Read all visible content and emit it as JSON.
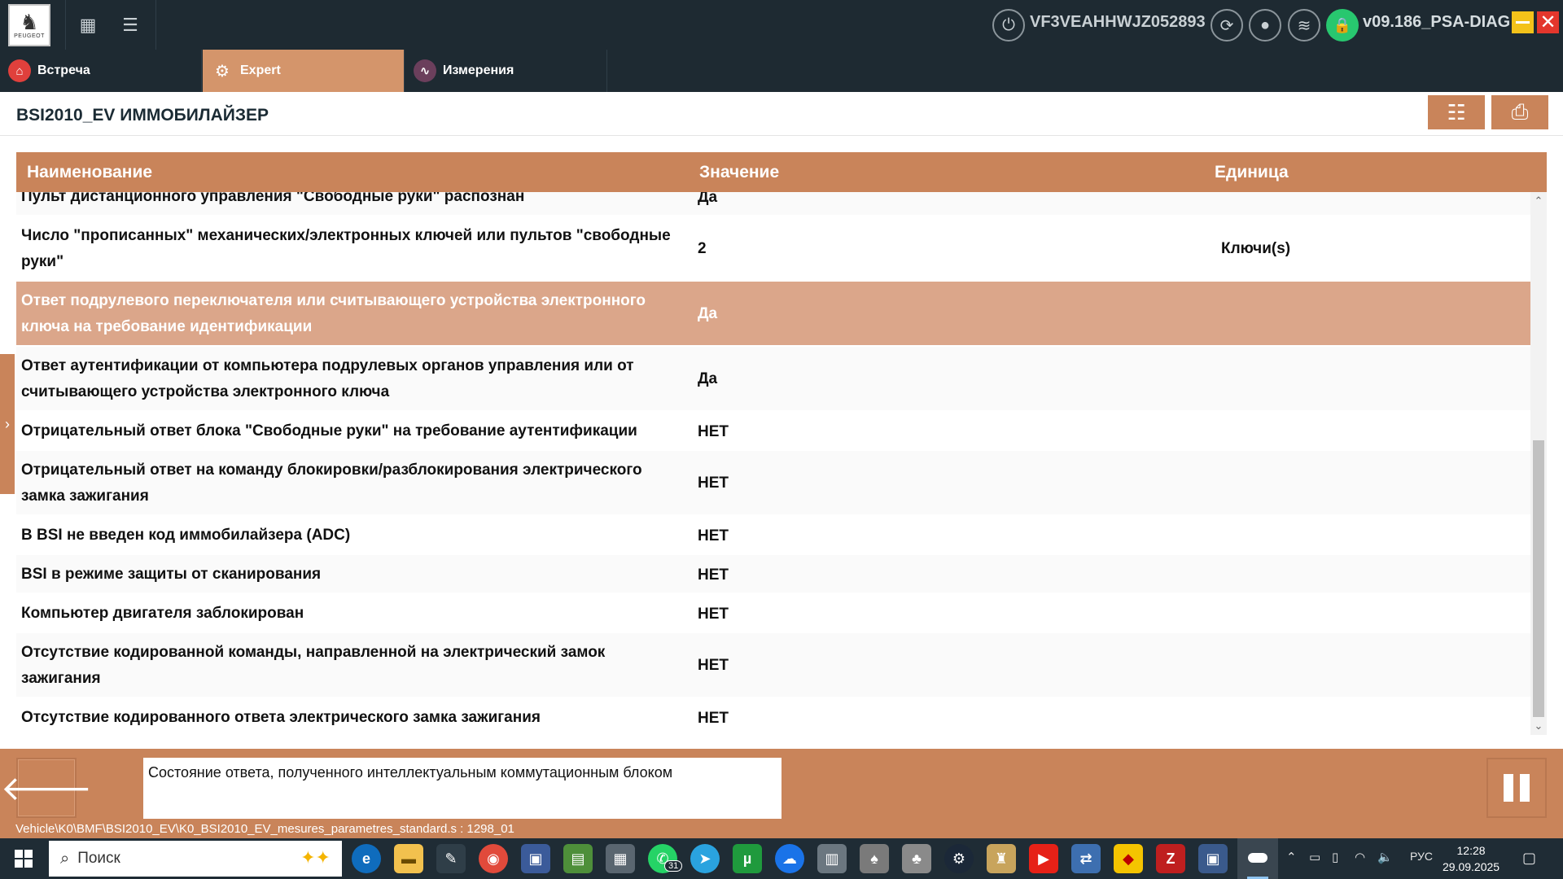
{
  "topbar": {
    "brand": "PEUGEOT",
    "vin": "VF3VEAHHWJZ052893",
    "version": "v09.186_PSA-DIAG",
    "icons": [
      "apps-grid-icon",
      "list-icon",
      "power-icon",
      "refresh-icon",
      "user-icon",
      "wifi-icon",
      "lock-icon"
    ]
  },
  "tabs": [
    {
      "label": "Встреча",
      "icon": "home-icon"
    },
    {
      "label": "Expert",
      "icon": "gears-icon"
    },
    {
      "label": "Измерения",
      "icon": "waveform-icon"
    }
  ],
  "page": {
    "title": "BSI2010_EV ИММОБИЛАЙЗЕР"
  },
  "table": {
    "headers": {
      "name": "Наименование",
      "value": "Значение",
      "unit": "Единица"
    },
    "rows": [
      {
        "name": "Пульт дистанционного управления \"Свободные руки\" распознан",
        "value": "Да",
        "unit": ""
      },
      {
        "name": "Число \"прописанных\" механических/электронных ключей или пультов \"свободные руки\"",
        "value": "2",
        "unit": "Ключи(s)"
      },
      {
        "name": "Ответ подрулевого переключателя или считывающего устройства электронного ключа на требование идентификации",
        "value": "Да",
        "unit": ""
      },
      {
        "name": "Ответ аутентификации от компьютера подрулевых органов управления или от считывающего устройства электронного ключа",
        "value": "Да",
        "unit": ""
      },
      {
        "name": "Отрицательный ответ блока \"Свободные руки\" на требование аутентификации",
        "value": "НЕТ",
        "unit": ""
      },
      {
        "name": "Отрицательный ответ на команду блокировки/разблокирования электрического замка зажигания",
        "value": "НЕТ",
        "unit": ""
      },
      {
        "name": "В BSI не введен код иммобилайзера (ADC)",
        "value": "НЕТ",
        "unit": ""
      },
      {
        "name": "BSI в режиме защиты от сканирования",
        "value": "НЕТ",
        "unit": ""
      },
      {
        "name": "Компьютер двигателя заблокирован",
        "value": "НЕТ",
        "unit": ""
      },
      {
        "name": "Отсутствие кодированной команды, направленной на электрический замок зажигания",
        "value": "НЕТ",
        "unit": ""
      },
      {
        "name": "Отсутствие кодированного ответа электрического замка зажигания",
        "value": "НЕТ",
        "unit": ""
      }
    ],
    "selected_row": 2
  },
  "bottom": {
    "description": "Состояние ответа, полученного интеллектуальным коммутационным блоком",
    "path": "Vehicle\\K0\\BMF\\BSI2010_EV\\K0_BSI2010_EV_mesures_parametres_standard.s : 1298_01"
  },
  "taskbar": {
    "search_placeholder": "Поиск",
    "badge": "31",
    "language": "РУС",
    "time": "12:28",
    "date": "29.09.2025"
  },
  "colors": {
    "accent": "#c9845a",
    "selected_row": "#dba68a",
    "dark_bar": "#1e2a32",
    "status_green": "#28c76f"
  }
}
